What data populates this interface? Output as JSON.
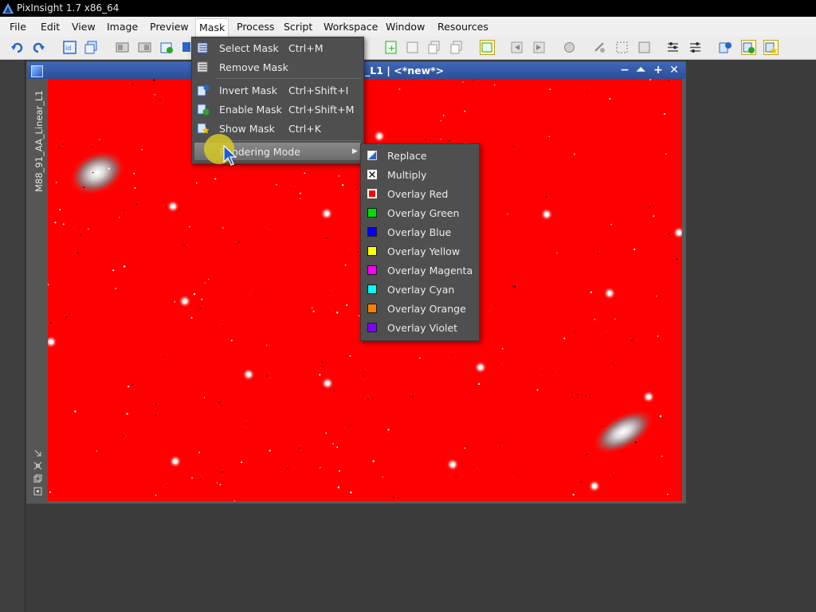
{
  "window": {
    "title": "PixInsight 1.7 x86_64"
  },
  "menubar": {
    "items": [
      "File",
      "Edit",
      "View",
      "Image",
      "Preview",
      "Mask",
      "Process",
      "Script",
      "Workspace",
      "Window",
      "Resources"
    ],
    "active": "Mask"
  },
  "image_window": {
    "title": "_L1 | <*new*>",
    "id_label": "M88_91_AA_Linear_L1",
    "buttons": {
      "minimize": "−",
      "shade": "⏶",
      "maximize": "+",
      "close": "✕"
    }
  },
  "mask_menu": {
    "items": [
      {
        "label": "Select Mask",
        "shortcut": "Ctrl+M",
        "icon": "select-mask-icon"
      },
      {
        "label": "Remove Mask",
        "shortcut": "",
        "icon": "remove-mask-icon"
      },
      {
        "label": "Invert Mask",
        "shortcut": "Ctrl+Shift+I",
        "icon": "invert-mask-icon"
      },
      {
        "label": "Enable Mask",
        "shortcut": "Ctrl+Shift+M",
        "icon": "enable-mask-icon"
      },
      {
        "label": "Show Mask",
        "shortcut": "Ctrl+K",
        "icon": "show-mask-icon"
      },
      {
        "label": "Rendering Mode",
        "shortcut": "",
        "icon": "",
        "submenu": true
      }
    ]
  },
  "rendering_mode_menu": {
    "items": [
      {
        "label": "Replace",
        "color": "replace"
      },
      {
        "label": "Multiply",
        "color": "multiply"
      },
      {
        "label": "Overlay Red",
        "color": "#ff0000"
      },
      {
        "label": "Overlay Green",
        "color": "#00e000"
      },
      {
        "label": "Overlay Blue",
        "color": "#0000ff"
      },
      {
        "label": "Overlay Yellow",
        "color": "#ffff00"
      },
      {
        "label": "Overlay Magenta",
        "color": "#ff00ff"
      },
      {
        "label": "Overlay Cyan",
        "color": "#00ffff"
      },
      {
        "label": "Overlay Orange",
        "color": "#ff8000"
      },
      {
        "label": "Overlay Violet",
        "color": "#8000ff"
      }
    ],
    "selected": "Overlay Red"
  },
  "colors": {
    "mask_overlay": "#ff0000",
    "title_bar_active": "#3f67b9",
    "menu_bg": "#4f4f4f"
  }
}
